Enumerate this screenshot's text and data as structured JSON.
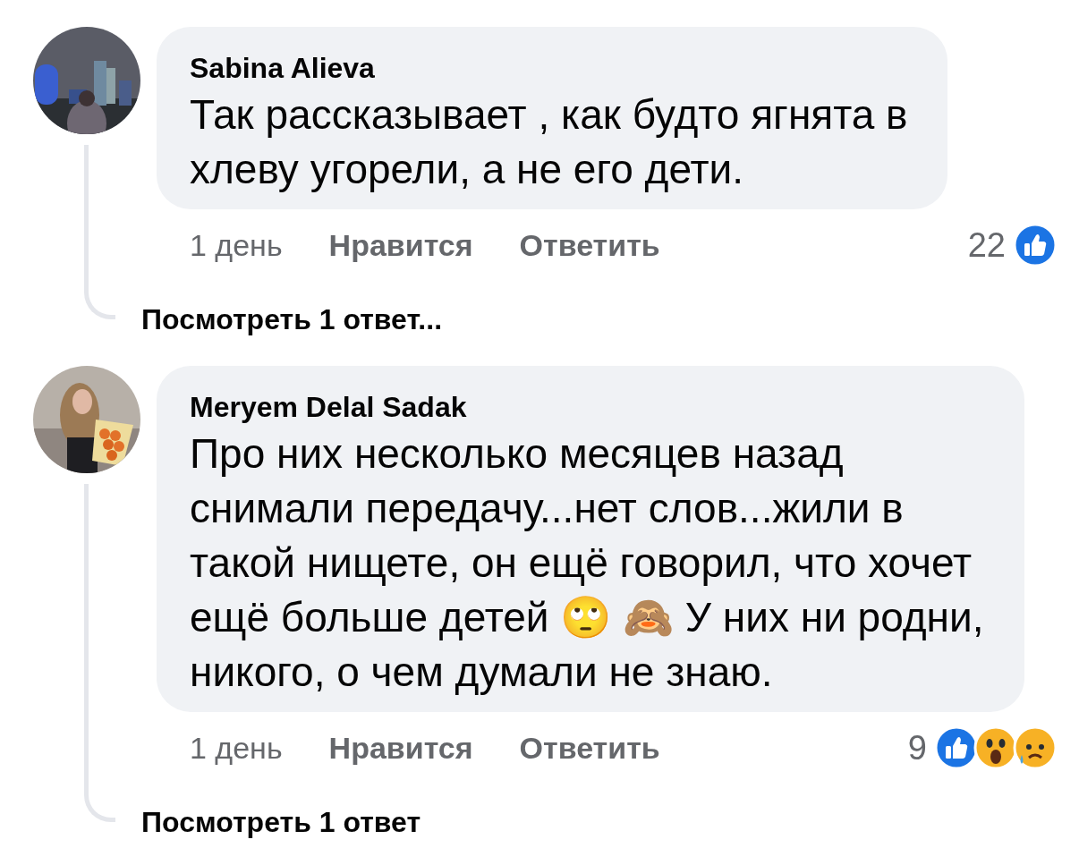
{
  "comments": [
    {
      "author": "Sabina Alieva",
      "text": "Так рассказывает , как будто ягнята в хлеву угорели, а не его дети.",
      "time": "1 день",
      "actions": [
        "Нравится",
        "Ответить"
      ],
      "reaction_count": "22",
      "reactions": [
        {
          "kind": "like"
        }
      ],
      "replies_link": "Посмотреть 1 ответ...",
      "avatar": {
        "kind": "picture"
      }
    },
    {
      "author": "Meryem Delal Sadak",
      "text": "Про них несколько месяцев назад снимали передачу...нет слов...жили в такой нищете, он ещё говорил, что хочет ещё больше детей 🙄 🙈 У них ни родни, никого, о чем думали не знаю.",
      "time": "1 день",
      "actions": [
        "Нравится",
        "Ответить"
      ],
      "reaction_count": "9",
      "reactions": [
        {
          "kind": "like"
        },
        {
          "kind": "wow"
        },
        {
          "kind": "sad"
        }
      ],
      "replies_link": "Посмотреть 1 ответ",
      "avatar": {
        "kind": "picture"
      }
    }
  ]
}
